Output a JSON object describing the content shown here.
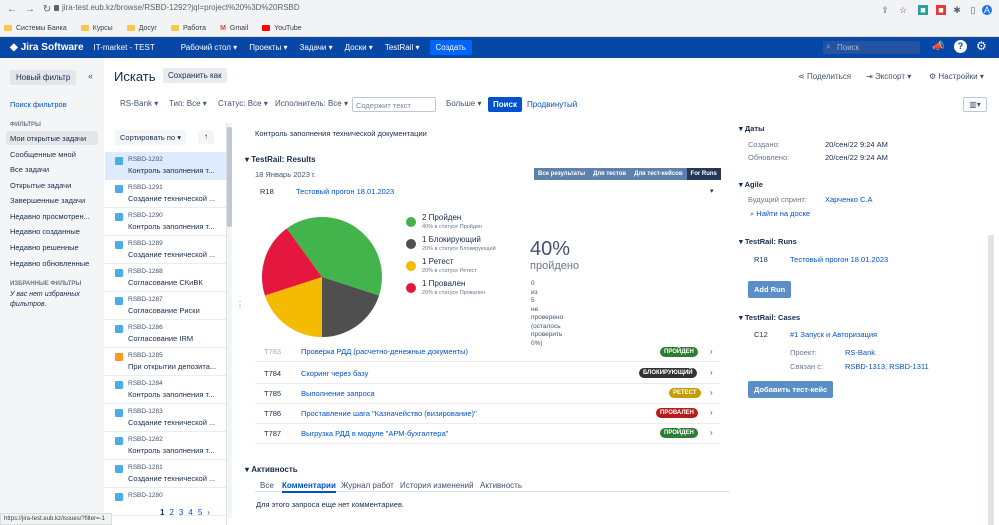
{
  "browser": {
    "url": "jira-test.eub.kz/browse/RSBD-1292?jql=project%20%3D%20RSBD",
    "bookmarks": [
      "Системы Банка",
      "Курсы",
      "Досуг",
      "Работа",
      "Gmail",
      "YouTube"
    ]
  },
  "topnav": {
    "logo": "Jira Software",
    "project": "IT-market - TEST",
    "items": [
      "Рабочий стол ▾",
      "Проекты ▾",
      "Задачи ▾",
      "Доски ▾",
      "TestRail ▾"
    ],
    "create": "Создать",
    "search_placeholder": "Поиск"
  },
  "sidebar": {
    "new_filter": "Новый фильтр",
    "search_filters": "Поиск фильтров",
    "filters_head": "ФИЛЬТРЫ",
    "items": [
      "Мои открытые задачи",
      "Сообщенные мной",
      "Все задачи",
      "Открытые задачи",
      "Завершенные задачи",
      "Недавно просмотрен...",
      "Недавно созданные",
      "Недавно решенные",
      "Недавно обновленные"
    ],
    "fav_head": "ИЗБРАННЫЕ ФИЛЬТРЫ",
    "fav_text1": "У вас нет избранных",
    "fav_text2": "фильтров."
  },
  "header": {
    "title": "Искать",
    "save_as": "Сохранить как",
    "share": "Поделиться",
    "export": "Экспорт ▾",
    "settings": "Настройки ▾"
  },
  "filters": {
    "project": "RS-Bank ▾",
    "type": "Тип: Все ▾",
    "status": "Статус: Все ▾",
    "assignee": "Исполнитель: Все ▾",
    "text_placeholder": "Содержит текст",
    "more": "Больше ▾",
    "search": "Поиск",
    "advanced": "Продвинутый"
  },
  "list": {
    "sort": "Сортировать по ▾",
    "issues": [
      {
        "key": "RSBD-1292",
        "summary": "Контроль заполнения т..."
      },
      {
        "key": "RSBD-1291",
        "summary": "Создание технической ..."
      },
      {
        "key": "RSBD-1290",
        "summary": "Контроль заполнения т..."
      },
      {
        "key": "RSBD-1289",
        "summary": "Создание технической ..."
      },
      {
        "key": "RSBD-1288",
        "summary": "Согласование СКиВК"
      },
      {
        "key": "RSBD-1287",
        "summary": "Согласование Риски"
      },
      {
        "key": "RSBD-1286",
        "summary": "Согласование IRM"
      },
      {
        "key": "RSBD-1285",
        "summary": "При открытии депозита..."
      },
      {
        "key": "RSBD-1284",
        "summary": "Контроль заполнения т..."
      },
      {
        "key": "RSBD-1283",
        "summary": "Создание технической ..."
      },
      {
        "key": "RSBD-1282",
        "summary": "Контроль заполнения т..."
      },
      {
        "key": "RSBD-1281",
        "summary": "Создание технической ..."
      },
      {
        "key": "RSBD-1280",
        "summary": ""
      }
    ],
    "pages": [
      "1",
      "2",
      "3",
      "4",
      "5",
      "›"
    ]
  },
  "main": {
    "description": "Контроль заполнения технической документации",
    "testrail_head": "TestRail: Results",
    "date": "18 Январь 2023 г.",
    "tabs": [
      "Все результаты",
      "Для тестов",
      "Для тест-кейсов",
      "For Runs"
    ],
    "run_id": "R18",
    "run_name": "Тестовый прогон 18.01.2023",
    "percent": "40%",
    "percent_label": "пройдено",
    "untested": [
      "0",
      "из",
      "5",
      "не",
      "проверено",
      "(осталось",
      "проверить",
      "0%)"
    ],
    "legend": [
      {
        "label": "2 Пройден",
        "sub": "40% в статусе Пройден",
        "color": "#43b34b"
      },
      {
        "label": "1 Блокирующий",
        "sub": "20% в статусе Блокирующий",
        "color": "#4f4f4f"
      },
      {
        "label": "1 Ретест",
        "sub": "20% в статусе Ретест",
        "color": "#f5bb00"
      },
      {
        "label": "1 Провален",
        "sub": "20% в статусе Провален",
        "color": "#e5173f"
      }
    ],
    "rows": [
      {
        "id": "T783",
        "name": "Проверка РДД (расчетно-денежные документы)",
        "badge": "ПРОЙДЕН",
        "color": "#2e7d32"
      },
      {
        "id": "T784",
        "name": "Скоринг через базу",
        "badge": "БЛОКИРУЮЩИЙ",
        "color": "#333333"
      },
      {
        "id": "T785",
        "name": "Выполнение запроса",
        "badge": "РЕТЕСТ",
        "color": "#c69c00"
      },
      {
        "id": "T786",
        "name": "Проставление шага \"Казначейство (визирование)\"",
        "badge": "ПРОВАЛЕН",
        "color": "#b71c1c"
      },
      {
        "id": "T787",
        "name": "Выгрузка РДД в модуле \"АРМ-бухгалтера\"",
        "badge": "ПРОЙДЕН",
        "color": "#2e7d32"
      }
    ],
    "activity_head": "Активность",
    "activity_tabs": [
      "Все",
      "Комментарии",
      "Журнал работ",
      "История изменений",
      "Активность"
    ],
    "no_comments": "Для этого запроса еще нет комментариев."
  },
  "right": {
    "dates_head": "Даты",
    "created_label": "Создано:",
    "created": "20/сен/22 9:24 AM",
    "updated_label": "Обновлено:",
    "updated": "20/сен/22 9:24 AM",
    "agile_head": "Agile",
    "sprint_label": "Будущий спринт:",
    "sprint": "Харченко С.А",
    "find_board": "Найти на доске",
    "runs_head": "TestRail: Runs",
    "run_id": "R18",
    "run_name": "Тестовый прогон 18.01.2023",
    "add_run": "Add Run",
    "cases_head": "TestRail: Cases",
    "case_id": "C12",
    "case_name": "#1 Запуск и Авторизация",
    "proj_label": "Проект:",
    "proj": "RS-Bank",
    "linked_label": "Связан с:",
    "linked": "RSBD-1313, RSBD-1311",
    "add_case": "Добавить тест-кейс"
  },
  "statusbar": "https://jira-test.eub.kz/issues/?filter=-1",
  "chart_data": {
    "type": "pie",
    "categories": [
      "Пройден",
      "Блокирующий",
      "Ретест",
      "Провален"
    ],
    "values": [
      2,
      1,
      1,
      1
    ],
    "colors": [
      "#43b34b",
      "#4f4f4f",
      "#f5bb00",
      "#e5173f"
    ]
  }
}
